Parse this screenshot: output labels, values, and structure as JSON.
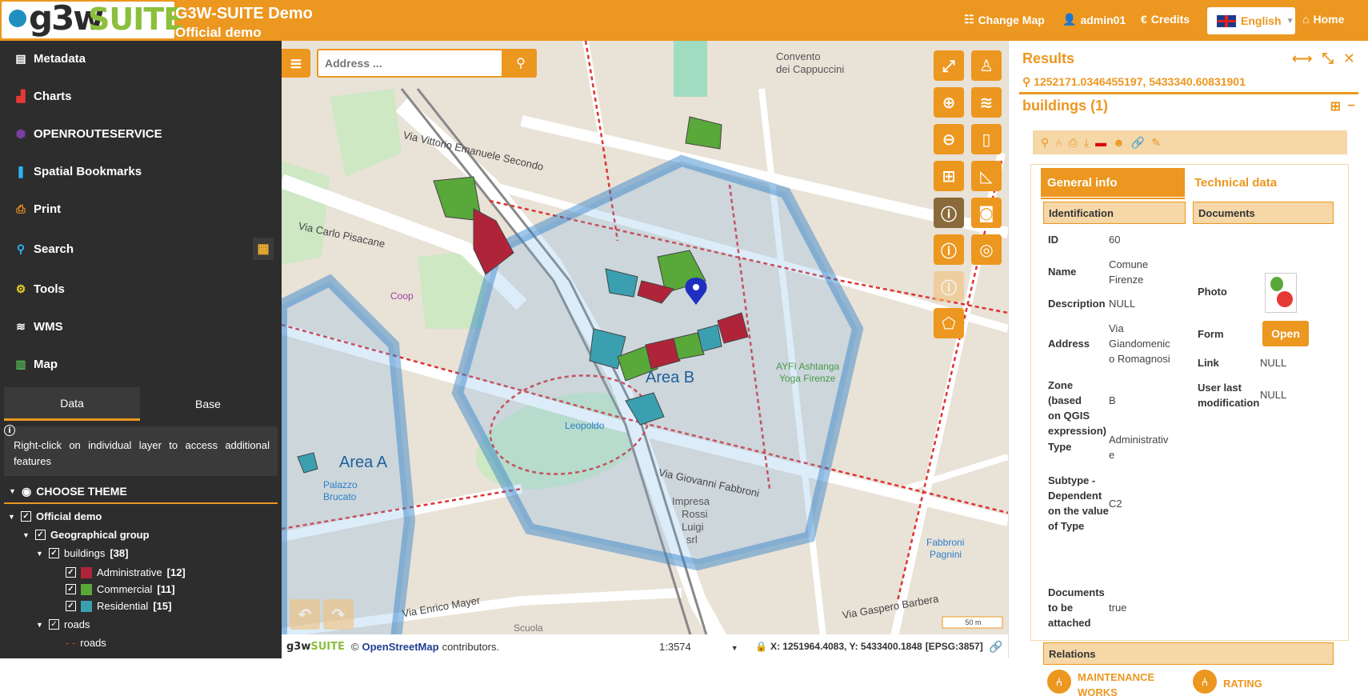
{
  "header": {
    "app_title": "G3W-SUITE Demo",
    "app_subtitle": "Official demo",
    "logo_text_g3w": "g3w",
    "logo_text_suite": "SUITE",
    "nav": {
      "change_map": "Change Map",
      "user": "admin01",
      "credits": "Credits",
      "language": "English",
      "home": "Home"
    }
  },
  "sidebar": {
    "items": [
      {
        "label": "Metadata",
        "icon": "file-icon",
        "color": "#ffffff"
      },
      {
        "label": "Charts",
        "icon": "chart-icon",
        "color": "#e53935"
      },
      {
        "label": "OPENROUTESERVICE",
        "icon": "hexagon-icon",
        "color": "#7b3fa0"
      },
      {
        "label": "Spatial Bookmarks",
        "icon": "bookmark-icon",
        "color": "#29b6f6"
      },
      {
        "label": "Print",
        "icon": "print-icon",
        "color": "#ec971f"
      },
      {
        "label": "Search",
        "icon": "search-icon",
        "color": "#29b6f6"
      },
      {
        "label": "Tools",
        "icon": "gears-icon",
        "color": "#f0d020"
      },
      {
        "label": "WMS",
        "icon": "layers-icon",
        "color": "#ffffff"
      },
      {
        "label": "Map",
        "icon": "map-icon",
        "color": "#4caf50"
      }
    ],
    "tabs": {
      "data": "Data",
      "base": "Base"
    },
    "info_text": "Right-click on individual layer to access additional features",
    "choose_theme": "CHOOSE THEME",
    "tree": {
      "project": "Official demo",
      "group": "Geographical group",
      "buildings": "buildings",
      "buildings_count": "[38]",
      "administrative": "Administrative",
      "administrative_count": "[12]",
      "commercial": "Commercial",
      "commercial_count": "[11]",
      "residential": "Residential",
      "residential_count": "[15]",
      "roads": "roads",
      "roads_leaf": "roads"
    },
    "colors": {
      "administrative": "#b0243a",
      "commercial": "#59a83a",
      "residential": "#3aa0b0"
    }
  },
  "map": {
    "search_placeholder": "Address ...",
    "areas": {
      "a": "Area A",
      "b": "Area B"
    },
    "scale": "1:3574",
    "coords": "X: 1251964.4083, Y: 5433400.1848",
    "epsg": "[EPSG:3857]",
    "attribution_pre": "©",
    "attribution_link": "OpenStreetMap",
    "attribution_post": "contributors.",
    "scalebar": "50 m",
    "labels": {
      "convento": "Convento",
      "cappuccini": "dei Cappuccini",
      "vittorio": "Via Vittorio Emanuele Secondo",
      "pisacane": "Via Carlo Pisacane",
      "giovanni_fabbroni": "Via Giovanni Fabbroni",
      "enrico_mayer": "Via Enrico Mayer",
      "gaspero_barbera": "Via Gaspero Barbera",
      "leopoldo": "Leopoldo",
      "coop": "Coop",
      "impresa": "Impresa",
      "rossi": "Rossi",
      "luigi": "Luigi",
      "srl": "srl",
      "ayfi": "AYFI Ashtanga",
      "yoga": "Yoga Firenze",
      "fabbroni_pagnini_1": "Fabbroni",
      "fabbroni_pagnini_2": "Pagnini",
      "scuola": "Scuola",
      "palazzo": "Palazzo",
      "brucato": "Brucato"
    }
  },
  "results": {
    "title": "Results",
    "coords": "1252171.0346455197, 5433340.60831901",
    "layer_title": "buildings (1)",
    "tab_general": "General info",
    "tab_technical": "Technical data",
    "section_identification": "Identification",
    "section_documents": "Documents",
    "section_relations": "Relations",
    "fields": {
      "id_k": "ID",
      "id_v": "60",
      "name_k": "Name",
      "name_v1": "Comune",
      "name_v2": "Firenze",
      "desc_k": "Description",
      "desc_v": "NULL",
      "addr_k": "Address",
      "addr_v1": "Via",
      "addr_v2": "Giandomenic",
      "addr_v3": "o Romagnosi",
      "zone_k1": "Zone (based",
      "zone_k2": "on QGIS",
      "zone_k3": "expression)",
      "zone_v": "B",
      "type_k": "Type",
      "type_v1": "Administrativ",
      "type_v2": "e",
      "sub_k1": "Subtype -",
      "sub_k2": "Dependent",
      "sub_k3": "on the value",
      "sub_k4": "of Type",
      "sub_v": "C2",
      "docs_k1": "Documents",
      "docs_k2": "to be",
      "docs_k3": "attached",
      "docs_v": "true",
      "photo_k": "Photo",
      "form_k": "Form",
      "form_btn": "Open",
      "link_k": "Link",
      "link_v": "NULL",
      "ulm_k1": "User last",
      "ulm_k2": "modification",
      "ulm_v": "NULL"
    },
    "relations": {
      "maint1": "MAINTENANCE",
      "maint2": "WORKS",
      "rating": "RATING"
    }
  }
}
